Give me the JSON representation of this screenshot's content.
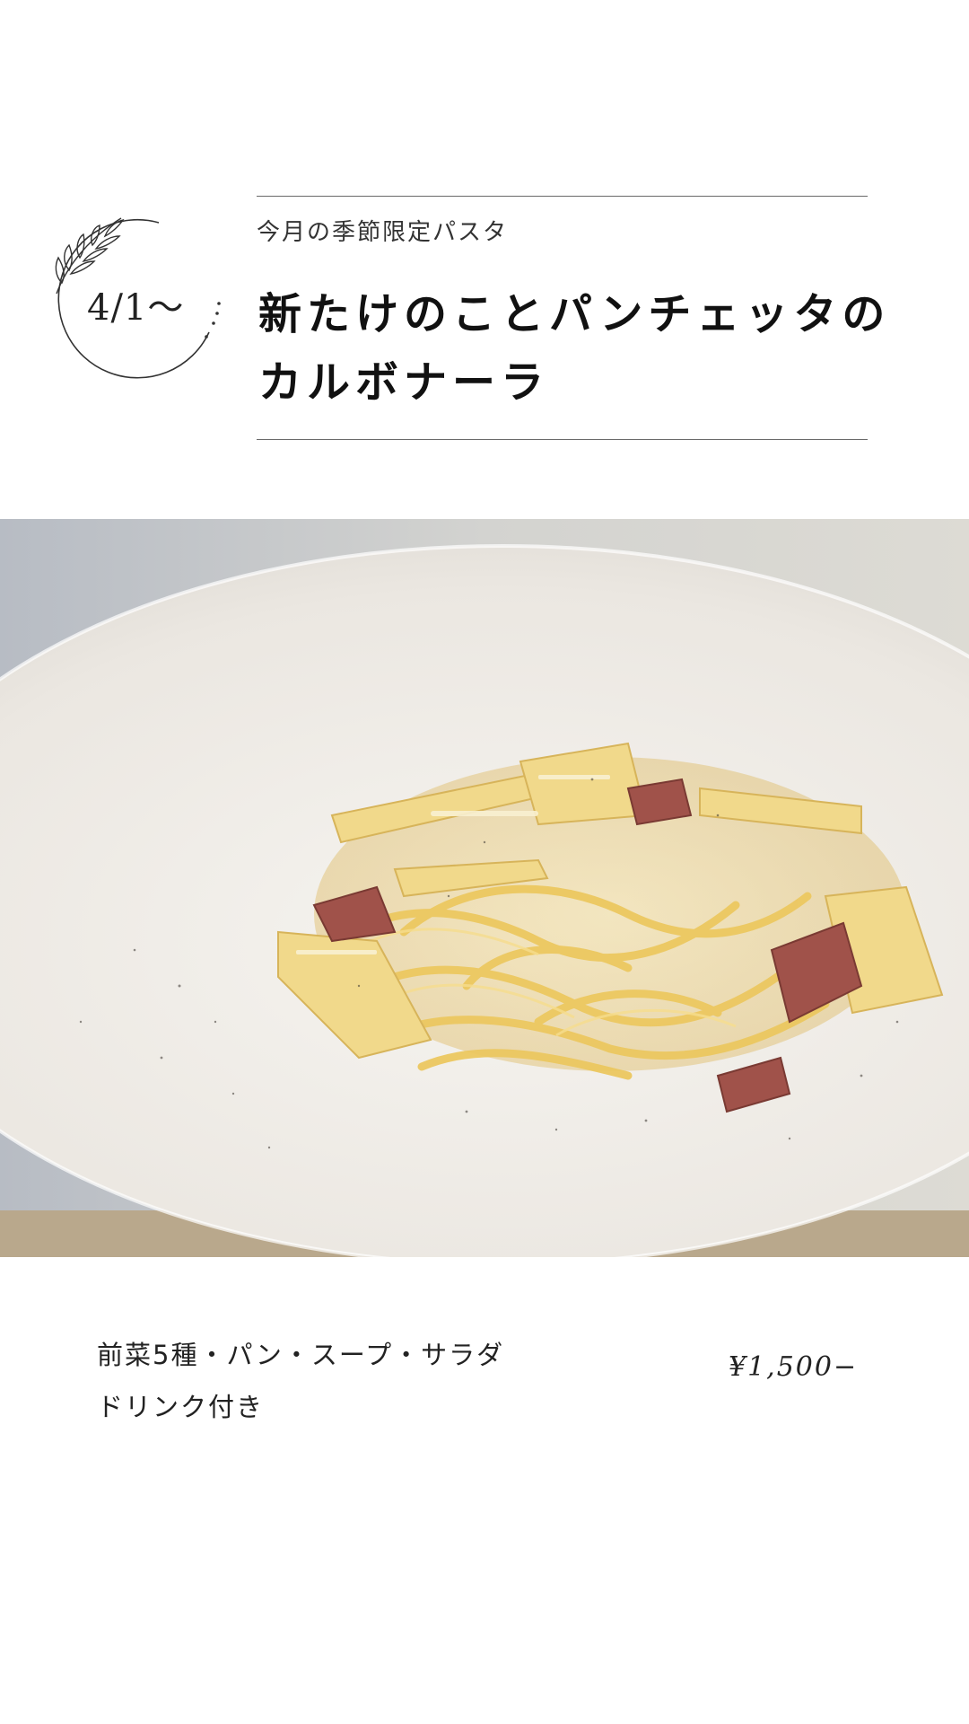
{
  "badge": {
    "date": "4/1〜"
  },
  "header": {
    "subtitle": "今月の季節限定パスタ",
    "title_line1": "新たけのことパンチェッタの",
    "title_line2": "カルボナーラ"
  },
  "photo": {
    "icon": "pasta-dish-photo"
  },
  "footer": {
    "courses_line1": "前菜5種・パン・スープ・サラダ",
    "courses_line2": "ドリンク付き",
    "price": "¥1,500−"
  },
  "colors": {
    "background": "#ffffff",
    "text": "#222222",
    "rule": "#6a6a6a",
    "plate": "#f2efea",
    "pasta": "#e8c45a"
  }
}
